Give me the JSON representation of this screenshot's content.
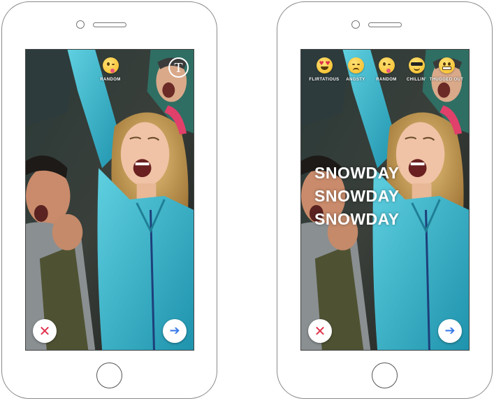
{
  "left_phone": {
    "mood_label": "RANDOM",
    "text_tool_glyph": "T",
    "cancel_glyph": "✕",
    "next_glyph": "➔"
  },
  "right_phone": {
    "moods": [
      {
        "label": "FLIRTATIOUS",
        "icon": "heart-eyes-emoji-icon"
      },
      {
        "label": "ANGSTY",
        "icon": "unamused-emoji-icon"
      },
      {
        "label": "RANDOM",
        "icon": "tongue-wink-emoji-icon"
      },
      {
        "label": "CHILLIN'",
        "icon": "sunglasses-emoji-icon"
      },
      {
        "label": "THUGGED OUT",
        "icon": "grimace-emoji-icon"
      }
    ],
    "caption_lines": [
      "SNOWDAY",
      "SNOWDAY",
      "SNOWDAY"
    ],
    "cancel_glyph": "✕",
    "next_glyph": "➔"
  },
  "colors": {
    "cancel": "#e0304b",
    "next": "#3a7bea",
    "jacket": "#35b6cf"
  }
}
